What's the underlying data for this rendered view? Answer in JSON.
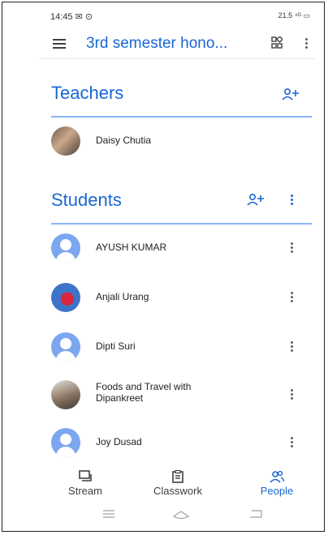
{
  "status": {
    "time_icons": "14:45 ✉ ⊙",
    "right": "21.5 ⁴ᴳ ▭"
  },
  "app": {
    "title": "3rd semester hono..."
  },
  "teachers": {
    "heading": "Teachers",
    "list": [
      {
        "name": "Daisy Chutia"
      }
    ]
  },
  "students": {
    "heading": "Students",
    "list": [
      {
        "name": "AYUSH KUMAR"
      },
      {
        "name": "Anjali Urang"
      },
      {
        "name": "Dipti Suri"
      },
      {
        "name": "Foods and Travel with Dipankreet"
      },
      {
        "name": "Joy Dusad"
      }
    ]
  },
  "tabs": [
    {
      "label": "Stream",
      "icon": "stream-icon"
    },
    {
      "label": "Classwork",
      "icon": "classwork-icon"
    },
    {
      "label": "People",
      "icon": "people-icon",
      "active": true
    }
  ],
  "colors": {
    "accent": "#1967d2",
    "divider": "#8ab4f8",
    "avatar_generic": "#7da6f0"
  }
}
